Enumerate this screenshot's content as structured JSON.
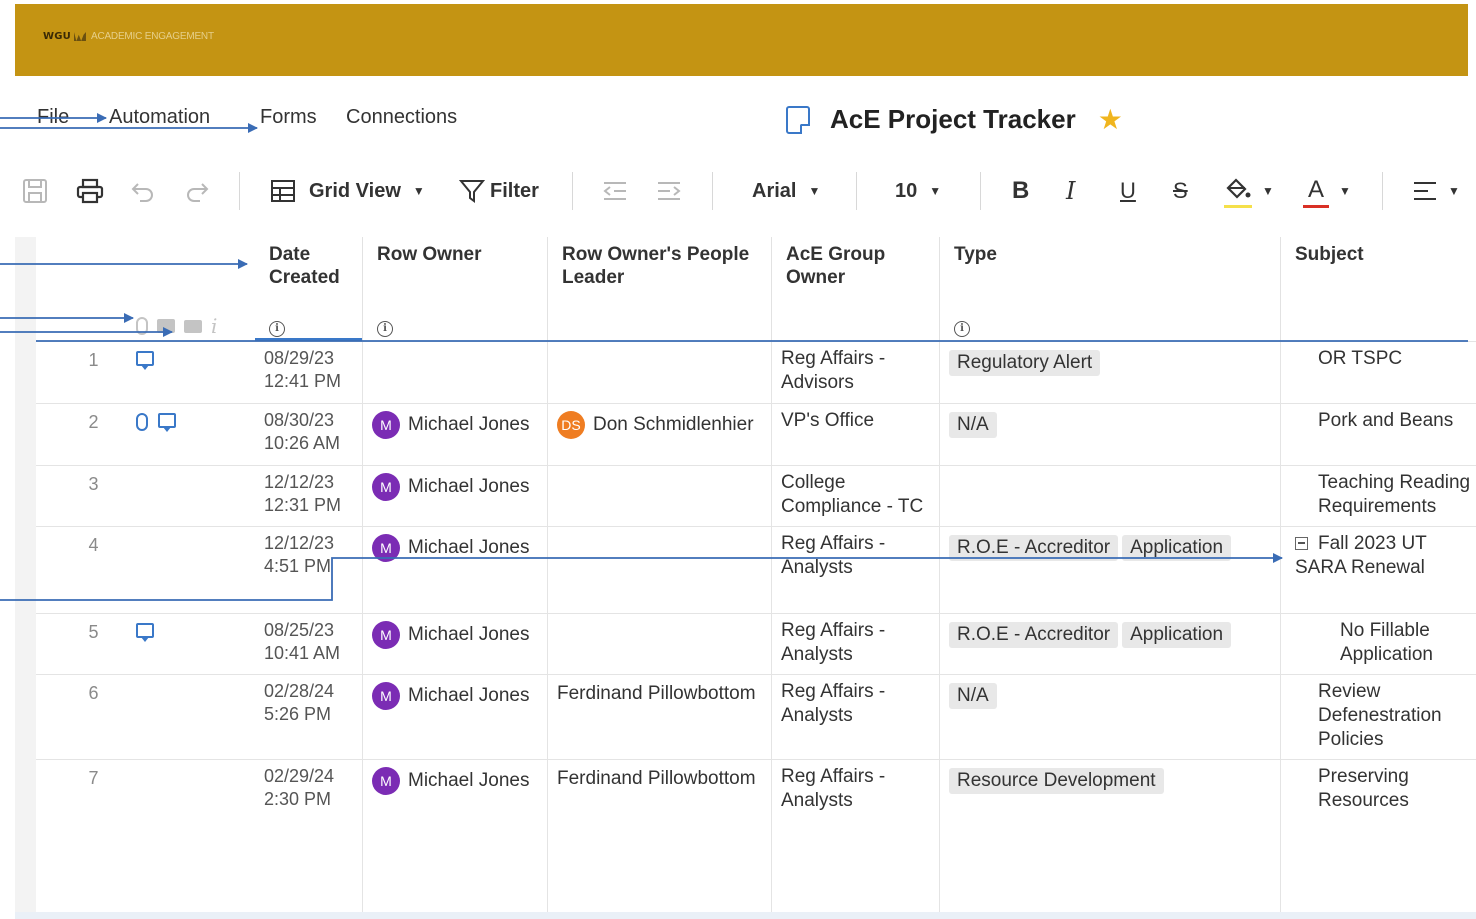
{
  "banner": {
    "brand": "WGU",
    "subtitle": "ACADEMIC ENGAGEMENT",
    "color": "#c49413"
  },
  "menu": {
    "file": "File",
    "automation": "Automation",
    "forms": "Forms",
    "connections": "Connections"
  },
  "sheet": {
    "title": "AcE Project Tracker",
    "favorite": true
  },
  "toolbar": {
    "view_label": "Grid View",
    "filter_label": "Filter",
    "font_family": "Arial",
    "font_size": "10",
    "bold_glyph": "B",
    "italic_glyph": "I",
    "underline_glyph": "U",
    "strike_glyph": "S",
    "text_color_glyph": "A",
    "highlight_color": "#f5e04a",
    "text_color": "#d93025"
  },
  "columns": {
    "date_created": "Date Created",
    "row_owner": "Row Owner",
    "people_leader": "Row Owner's People Leader",
    "group_owner": "AcE Group Owner",
    "type": "Type",
    "subject": "Subject"
  },
  "rows": [
    {
      "num": "1",
      "date": "08/29/23",
      "time": "12:41 PM",
      "owner": "",
      "leader": "",
      "group_line1": "Reg Affairs -",
      "group_line2": "Advisors",
      "tags": [
        "Regulatory Alert"
      ],
      "subject_line1": "OR TSPC",
      "subject_line2": "",
      "subject_line3": ""
    },
    {
      "num": "2",
      "date": "08/30/23",
      "time": "10:26 AM",
      "owner": "Michael Jones",
      "owner_initial": "M",
      "leader": "Don Schmidlenhier",
      "leader_initials": "DS",
      "group_line1": "VP's Office",
      "group_line2": "",
      "tags": [
        "N/A"
      ],
      "subject_line1": "Pork and Beans",
      "subject_line2": "",
      "subject_line3": ""
    },
    {
      "num": "3",
      "date": "12/12/23",
      "time": "12:31 PM",
      "owner": "Michael Jones",
      "owner_initial": "M",
      "leader": "",
      "group_line1": "College",
      "group_line2": "Compliance - TC",
      "tags": [],
      "subject_line1": "Teaching Reading",
      "subject_line2": "Requirements",
      "subject_line3": ""
    },
    {
      "num": "4",
      "date": "12/12/23",
      "time": "4:51 PM",
      "owner": "Michael Jones",
      "owner_initial": "M",
      "leader": "",
      "group_line1": "Reg Affairs -",
      "group_line2": "Analysts",
      "tags": [
        "R.O.E - Accreditor",
        "Application"
      ],
      "subject_line1": "Fall 2023 UT",
      "subject_line2": "SARA Renewal",
      "subject_line3": ""
    },
    {
      "num": "5",
      "date": "08/25/23",
      "time": "10:41 AM",
      "owner": "Michael Jones",
      "owner_initial": "M",
      "leader": "",
      "group_line1": "Reg Affairs -",
      "group_line2": "Analysts",
      "tags": [
        "R.O.E - Accreditor",
        "Application"
      ],
      "subject_line1": "No Fillable",
      "subject_line2": "Application",
      "subject_line3": ""
    },
    {
      "num": "6",
      "date": "02/28/24",
      "time": "5:26 PM",
      "owner": "Michael Jones",
      "owner_initial": "M",
      "leader": "Ferdinand Pillowbottom",
      "group_line1": "Reg Affairs -",
      "group_line2": "Analysts",
      "tags": [
        "N/A"
      ],
      "subject_line1": "Review",
      "subject_line2": "Defenestration",
      "subject_line3": "Policies"
    },
    {
      "num": "7",
      "date": "02/29/24",
      "time": "2:30 PM",
      "owner": "Michael Jones",
      "owner_initial": "M",
      "leader": "Ferdinand Pillowbottom",
      "group_line1": "Reg Affairs -",
      "group_line2": "Analysts",
      "tags": [
        "Resource Development"
      ],
      "subject_line1": "Preserving",
      "subject_line2": "Resources",
      "subject_line3": ""
    }
  ],
  "colors": {
    "accent": "#3a78c8",
    "avatar_m": "#7b2cb4",
    "avatar_ds": "#ef7d22",
    "star": "#f0b51e"
  }
}
